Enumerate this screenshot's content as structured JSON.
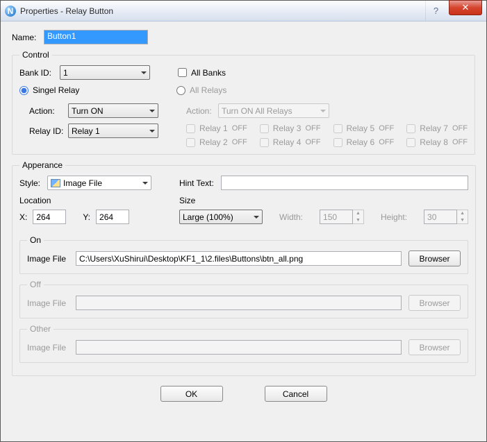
{
  "window": {
    "title": "Properties - Relay Button",
    "help_glyph": "?",
    "close_glyph": "✕",
    "app_icon_letter": "N"
  },
  "name": {
    "label": "Name:",
    "value": "Button1"
  },
  "control": {
    "legend": "Control",
    "bank_id_label": "Bank ID:",
    "bank_id_value": "1",
    "all_banks_label": "All Banks",
    "single_relay_label": "Singel Relay",
    "all_relays_label": "All Relays",
    "single": {
      "action_label": "Action:",
      "action_value": "Turn ON",
      "relay_id_label": "Relay ID:",
      "relay_id_value": "Relay 1"
    },
    "all": {
      "action_label": "Action:",
      "action_value": "Turn ON All Relays",
      "relays": [
        {
          "name": "Relay 1",
          "state": "OFF"
        },
        {
          "name": "Relay 2",
          "state": "OFF"
        },
        {
          "name": "Relay 3",
          "state": "OFF"
        },
        {
          "name": "Relay 4",
          "state": "OFF"
        },
        {
          "name": "Relay 5",
          "state": "OFF"
        },
        {
          "name": "Relay 6",
          "state": "OFF"
        },
        {
          "name": "Relay 7",
          "state": "OFF"
        },
        {
          "name": "Relay 8",
          "state": "OFF"
        }
      ]
    }
  },
  "appearance": {
    "legend": "Apperance",
    "style_label": "Style:",
    "style_value": "Image File",
    "hint_label": "Hint Text:",
    "hint_value": "",
    "location": {
      "legend": "Location",
      "x_label": "X:",
      "x_value": "264",
      "y_label": "Y:",
      "y_value": "264"
    },
    "size": {
      "legend": "Size",
      "preset_value": "Large    (100%)",
      "width_label": "Width:",
      "width_value": "150",
      "height_label": "Height:",
      "height_value": "30"
    },
    "on": {
      "legend": "On",
      "label": "Image File",
      "value": "C:\\Users\\XuShirui\\Desktop\\KF1_1\\2.files\\Buttons\\btn_all.png",
      "browse": "Browser"
    },
    "off": {
      "legend": "Off",
      "label": "Image File",
      "value": "",
      "browse": "Browser"
    },
    "other": {
      "legend": "Other",
      "label": "Image File",
      "value": "",
      "browse": "Browser"
    }
  },
  "footer": {
    "ok": "OK",
    "cancel": "Cancel"
  }
}
